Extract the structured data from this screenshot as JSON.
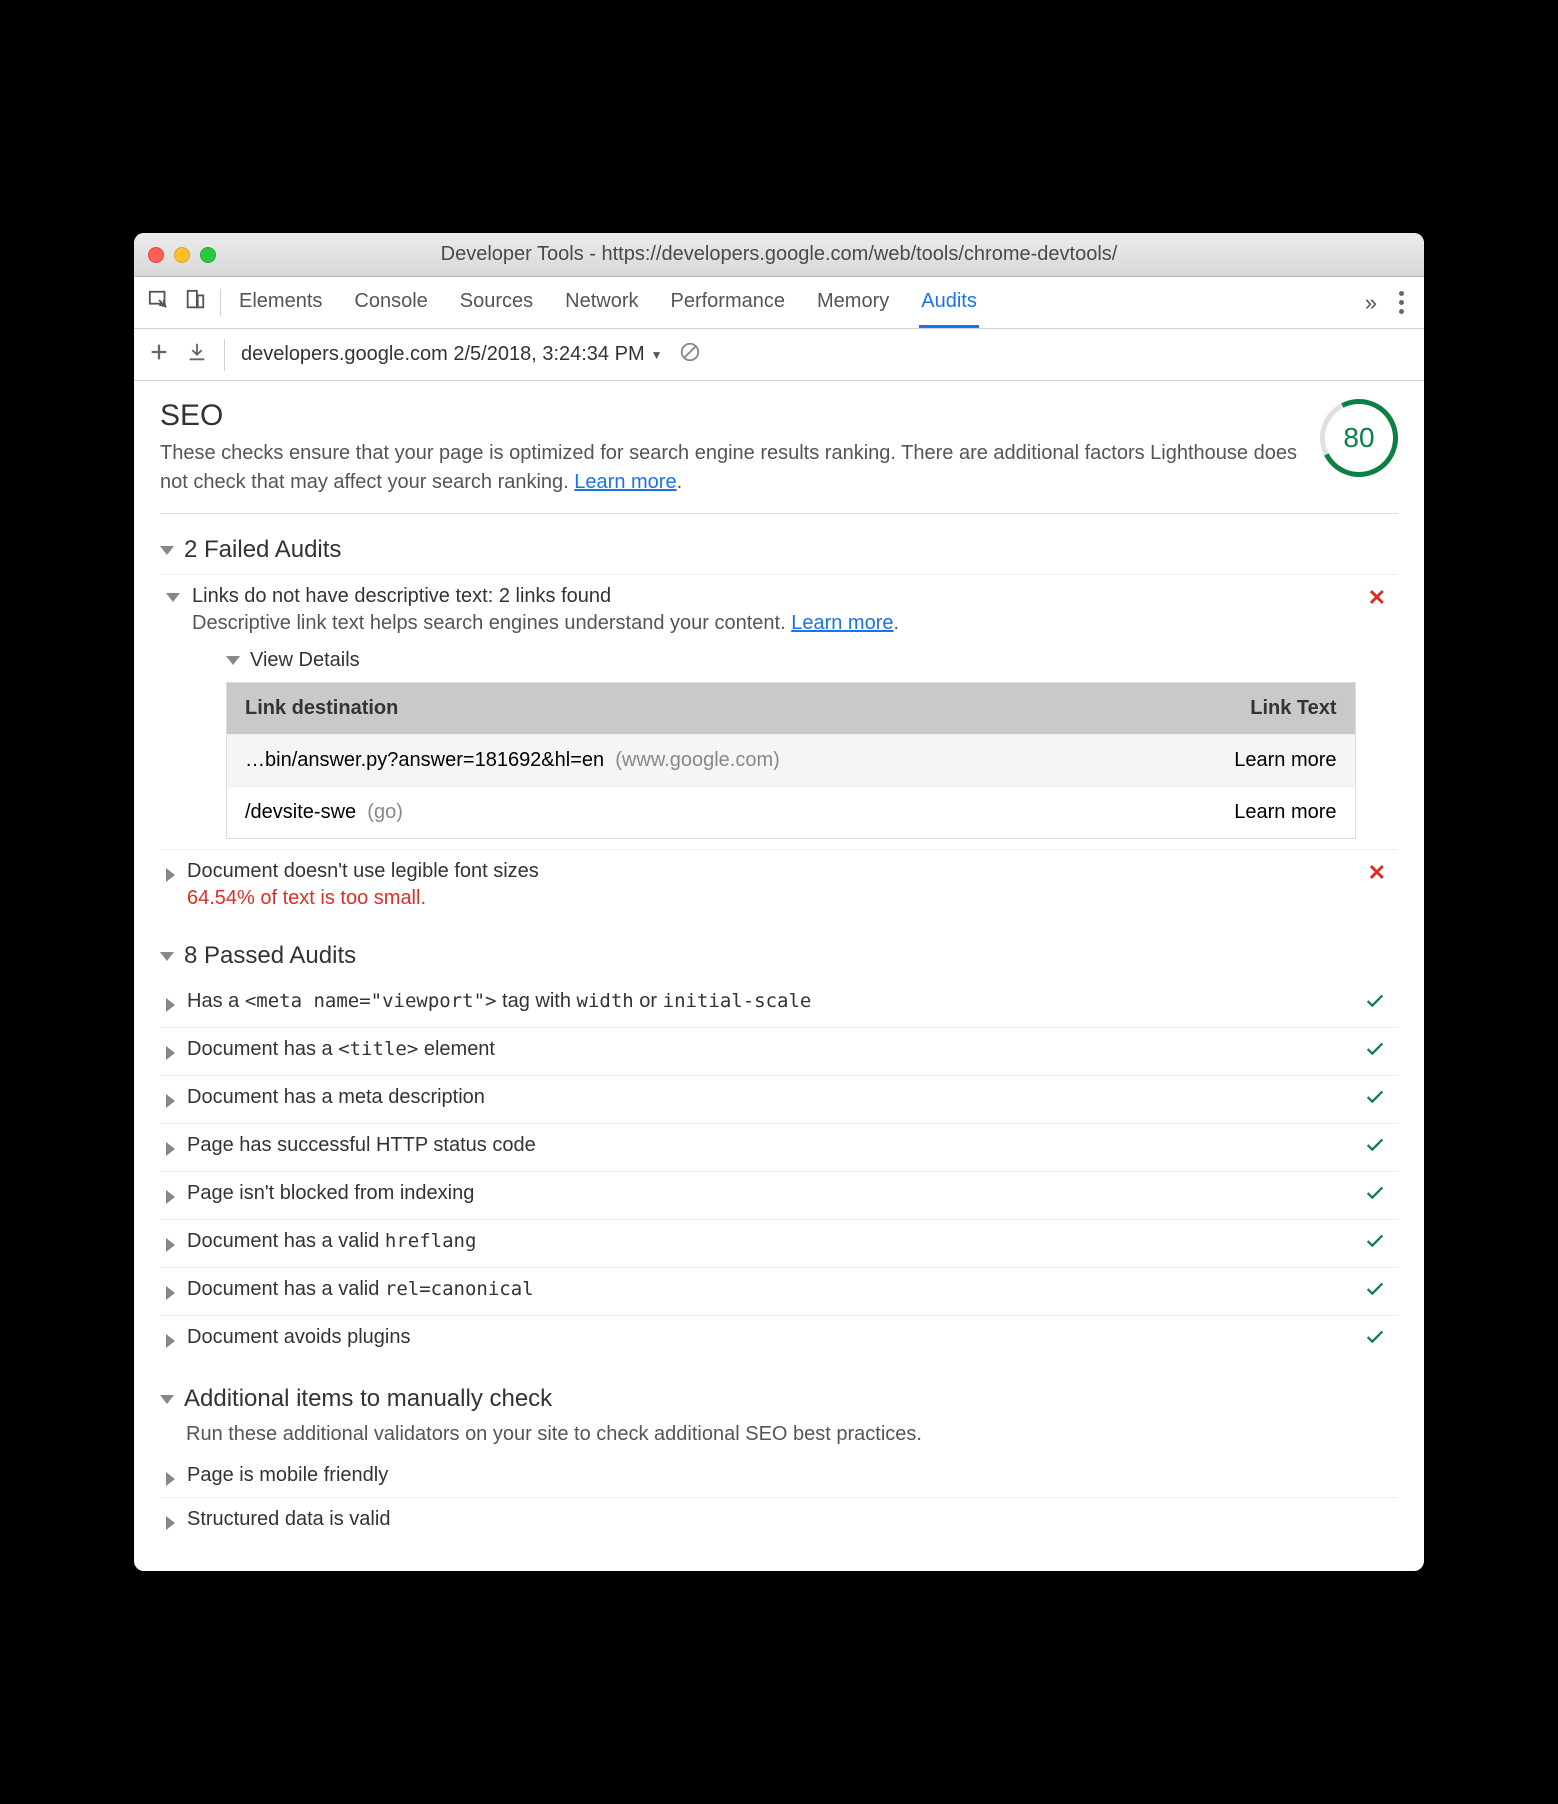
{
  "window": {
    "title": "Developer Tools - https://developers.google.com/web/tools/chrome-devtools/"
  },
  "tabs": {
    "items": [
      "Elements",
      "Console",
      "Sources",
      "Network",
      "Performance",
      "Memory",
      "Audits"
    ],
    "active": "Audits",
    "overflow": "»"
  },
  "toolbar": {
    "report_label": "developers.google.com 2/5/2018, 3:24:34 PM"
  },
  "seo": {
    "heading": "SEO",
    "description": "These checks ensure that your page is optimized for search engine results ranking. There are additional factors Lighthouse does not check that may affect your search ranking. ",
    "learn_more": "Learn more",
    "score": "80"
  },
  "failed": {
    "heading": "2 Failed Audits",
    "audits": [
      {
        "title": "Links do not have descriptive text: 2 links found",
        "sub_pre": "Descriptive link text helps search engines understand your content. ",
        "learn_more": "Learn more",
        "view_details": "View Details",
        "table": {
          "col1": "Link destination",
          "col2": "Link Text",
          "rows": [
            {
              "dest": "…bin/answer.py?answer=181692&hl=en",
              "domain": "(www.google.com)",
              "text": "Learn more"
            },
            {
              "dest": "/devsite-swe",
              "domain": "(go)",
              "text": "Learn more"
            }
          ]
        }
      },
      {
        "title": "Document doesn't use legible font sizes",
        "warn": "64.54% of text is too small."
      }
    ]
  },
  "passed": {
    "heading": "8 Passed Audits",
    "audits": [
      {
        "pre": "Has a ",
        "code": "<meta name=\"viewport\">",
        "mid": " tag with ",
        "code2": "width",
        "mid2": " or ",
        "code3": "initial-scale"
      },
      {
        "pre": "Document has a ",
        "code": "<title>",
        "mid": " element"
      },
      {
        "pre": "Document has a meta description"
      },
      {
        "pre": "Page has successful HTTP status code"
      },
      {
        "pre": "Page isn't blocked from indexing"
      },
      {
        "pre": "Document has a valid ",
        "code": "hreflang"
      },
      {
        "pre": "Document has a valid ",
        "code": "rel=canonical"
      },
      {
        "pre": "Document avoids plugins"
      }
    ]
  },
  "manual": {
    "heading": "Additional items to manually check",
    "desc": "Run these additional validators on your site to check additional SEO best practices.",
    "items": [
      "Page is mobile friendly",
      "Structured data is valid"
    ]
  }
}
